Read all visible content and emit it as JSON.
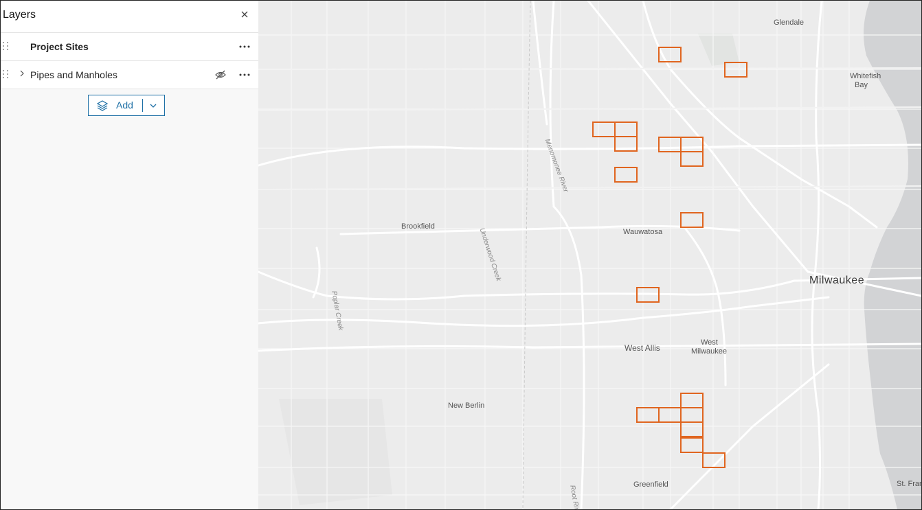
{
  "panel": {
    "title": "Layers",
    "close_icon": "close-icon",
    "layers": [
      {
        "name": "Project Sites",
        "bold": true,
        "expandable": false,
        "hidden": false
      },
      {
        "name": "Pipes and Manholes",
        "bold": false,
        "expandable": true,
        "hidden": true
      }
    ],
    "add_label": "Add"
  },
  "map": {
    "places": [
      {
        "id": "glendale",
        "name": "Glendale"
      },
      {
        "id": "whitefish-bay-1",
        "name": "Whitefish"
      },
      {
        "id": "whitefish-bay-2",
        "name": "Bay"
      },
      {
        "id": "brookfield",
        "name": "Brookfield"
      },
      {
        "id": "wauwatosa",
        "name": "Wauwatosa"
      },
      {
        "id": "milwaukee",
        "name": "Milwaukee"
      },
      {
        "id": "west-allis",
        "name": "West Allis"
      },
      {
        "id": "west-milwaukee-1",
        "name": "West"
      },
      {
        "id": "west-milwaukee-2",
        "name": "Milwaukee"
      },
      {
        "id": "new-berlin",
        "name": "New Berlin"
      },
      {
        "id": "greenfield",
        "name": "Greenfield"
      },
      {
        "id": "st-francis",
        "name": "St. Fran"
      }
    ],
    "water_labels": [
      {
        "id": "menomonee",
        "name": "Menomonee River"
      },
      {
        "id": "underwood",
        "name": "Underwood Creek"
      },
      {
        "id": "poplar",
        "name": "Poplar Creek"
      },
      {
        "id": "root",
        "name": "Root Riv"
      }
    ],
    "project_site_color": "#e0651f",
    "project_site_count": 21
  }
}
